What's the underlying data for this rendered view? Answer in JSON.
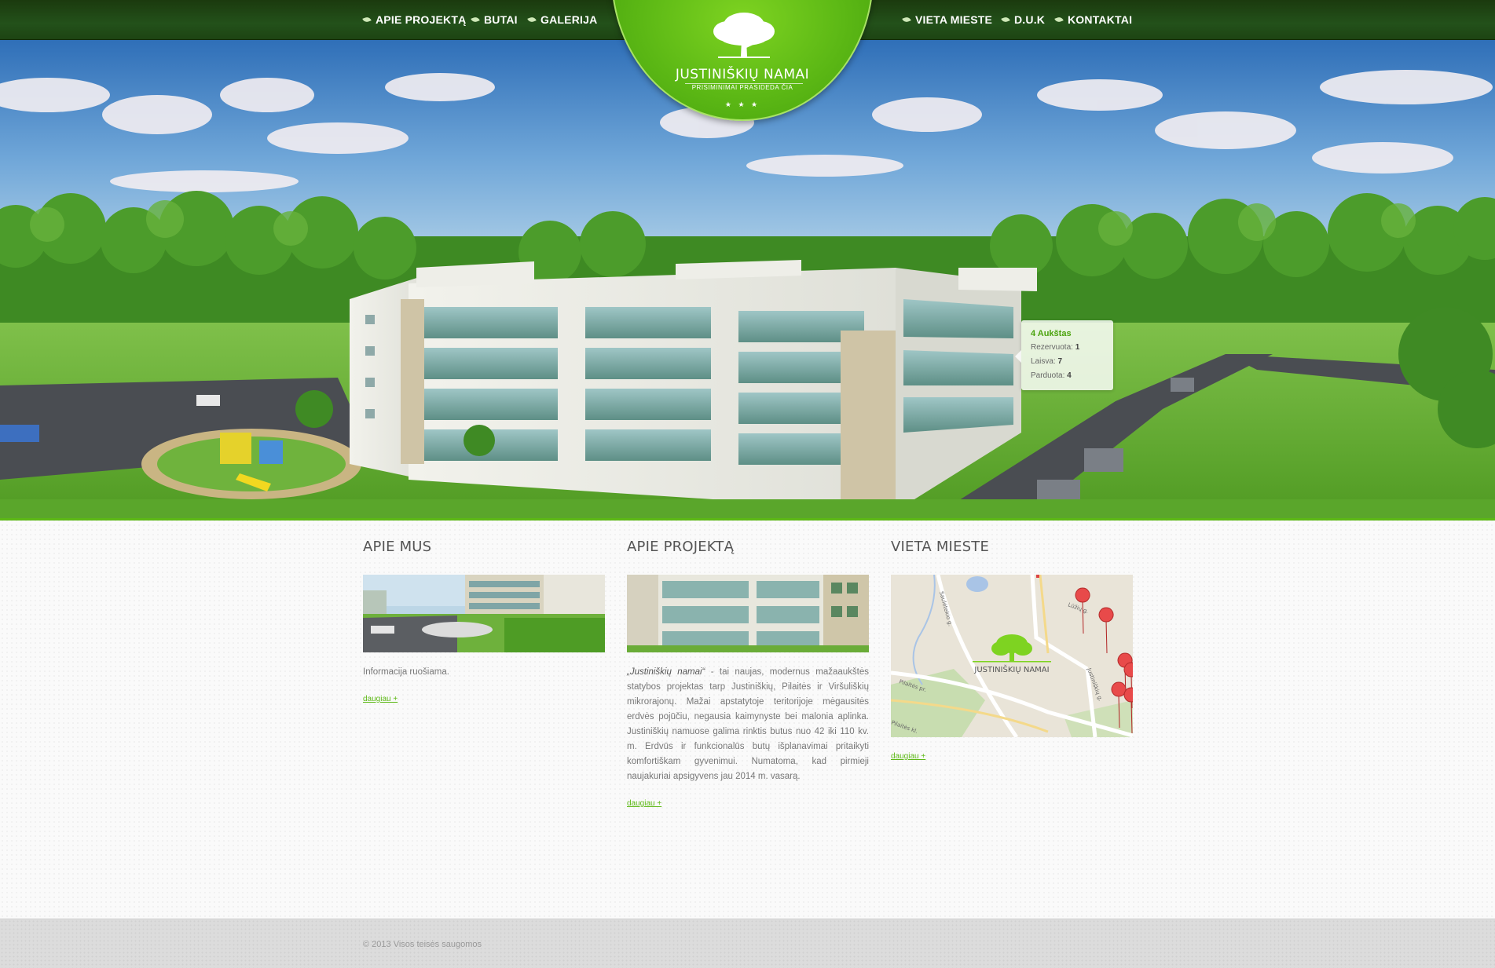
{
  "nav": {
    "left": [
      "APIE PROJEKTĄ",
      "BUTAI",
      "GALERIJA"
    ],
    "right": [
      "VIETA MIESTE",
      "D.U.K",
      "KONTAKTAI"
    ]
  },
  "logo": {
    "title": "JUSTINIŠKIŲ NAMAI",
    "subtitle": "PRISIMINIMAI PRASIDEDA ČIA",
    "stars": "★ ★ ★"
  },
  "floor_tooltip": {
    "title": "4 Aukštas",
    "reserved_label": "Rezervuota:",
    "reserved_value": "1",
    "free_label": "Laisva:",
    "free_value": "7",
    "sold_label": "Parduota:",
    "sold_value": "4"
  },
  "columns": [
    {
      "title": "APIE MUS",
      "text": "Informacija ruošiama.",
      "more": "daugiau +"
    },
    {
      "title": "APIE PROJEKTĄ",
      "text_em": "„Justiniškių namai“",
      "text": " - tai naujas, modernus mažaaukštės statybos projektas tarp Justiniškių, Pilaitės ir Viršuliškių mikrorajonų. Mažai apstatytoje teritorijoje mėgausitės erdvės pojūčiu, negausia kaimynyste bei malonia aplinka. Justiniškių namuose galima rinktis butus nuo 42 iki 110 kv. m. Erdvūs ir funkcionalūs butų išplanavimai pritaikyti komfortiškam gyvenimui. Numatoma, kad pirmieji naujakuriai apsigyvens jau 2014 m. vasarą.",
      "more": "daugiau +"
    },
    {
      "title": "VIETA MIESTE",
      "map": {
        "logo_text": "JUSTINIŠKIŲ NAMAI",
        "streets": [
          "Saulėtekio g.",
          "Lūžių g.",
          "Pilaitės pr.",
          "Justiniškių g.",
          "Pilaitės kl."
        ]
      },
      "more": "daugiau +"
    }
  ],
  "footer": {
    "text": "© 2013 Visos teisės saugomos"
  },
  "colors": {
    "accent": "#5cb815",
    "nav_bg": "#1f4a14"
  }
}
